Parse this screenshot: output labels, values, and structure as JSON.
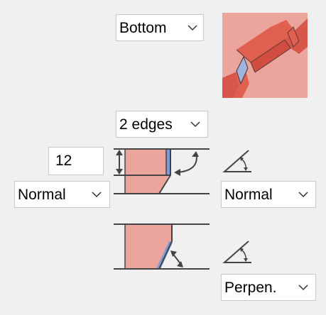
{
  "bevel_panel": {
    "position_select": {
      "value": "Bottom"
    },
    "edges_select": {
      "value": "2 edges"
    },
    "depth_input": {
      "value": "12"
    },
    "left_angle_select": {
      "value": "Normal"
    },
    "right_angle_select": {
      "value": "Normal"
    },
    "lower_angle_select": {
      "value": "Perpen."
    }
  },
  "icons": {
    "preview": "bevel-preview-3d-icon",
    "chevron": "chevron-down-icon",
    "angle": "angle-icon",
    "depth_diagram": "bevel-depth-diagram",
    "perpendicular_diagram": "bevel-perpendicular-diagram"
  },
  "colors": {
    "fill_salmon": "#eba59c",
    "fill_red": "#e0604f",
    "edge_blue": "#7b9cdb",
    "line": "#444444"
  }
}
